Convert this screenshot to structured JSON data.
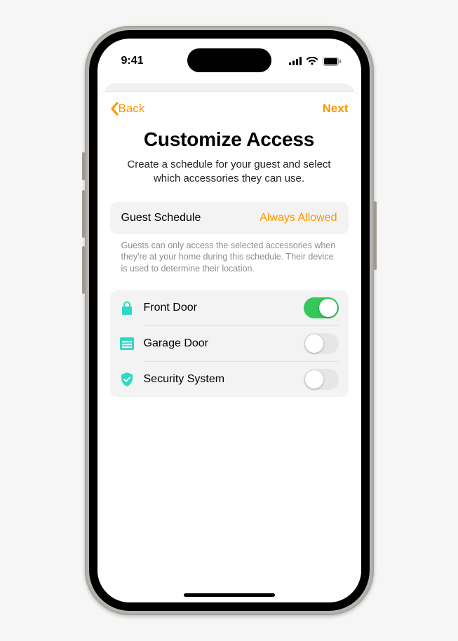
{
  "status": {
    "time": "9:41"
  },
  "nav": {
    "back": "Back",
    "next": "Next"
  },
  "header": {
    "title": "Customize Access",
    "subtitle": "Create a schedule for your guest and select which accessories they can use."
  },
  "schedule": {
    "label": "Guest Schedule",
    "value": "Always Allowed"
  },
  "footnote": "Guests can only access the selected accessories when they're at your home during this schedule. Their device is used to determine their location.",
  "accessories": [
    {
      "icon": "lock",
      "label": "Front Door",
      "on": true
    },
    {
      "icon": "garage",
      "label": "Garage Door",
      "on": false
    },
    {
      "icon": "shield",
      "label": "Security System",
      "on": false
    }
  ],
  "colors": {
    "accent": "#ff9500",
    "iconTeal": "#2fd8c5",
    "toggleOn": "#34c759"
  }
}
